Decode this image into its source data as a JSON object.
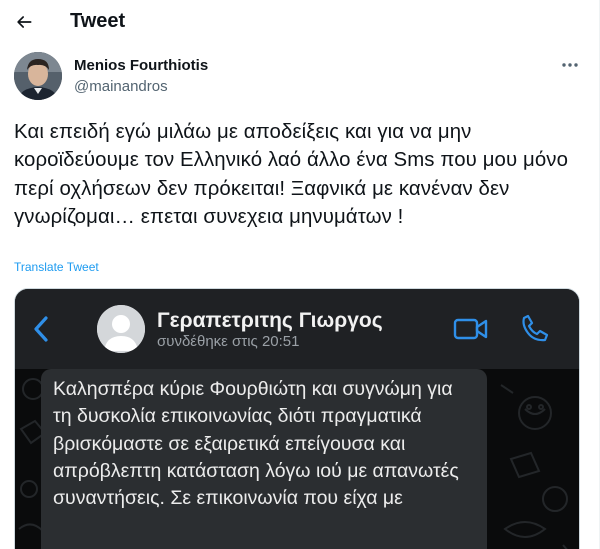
{
  "header": {
    "title": "Tweet",
    "back_icon": "arrow-left-icon"
  },
  "author": {
    "name": "Menios Fourthiotis",
    "handle": "@mainandros",
    "more_icon": "more-horizontal-icon"
  },
  "tweet": {
    "text": "Και επειδή εγώ μιλάω με αποδείξεις και για να μην κοροϊδεύουμε τον Ελληνικό λαό άλλο ένα Sms που μου μόνο περί οχλήσεων δεν πρόκειται! Ξαφνικά με κανέναν δεν γνωρίζομαι… επεται συνεχεια μηνυμάτων !",
    "translate_label": "Translate Tweet"
  },
  "media": {
    "contact_name": "Γεραπετριτης Γιωργος",
    "contact_status": "συνδέθηκε στις 20:51",
    "message_text": "Καλησπέρα κύριε Φουρθιώτη και συγνώμη για τη δυσκολία επικοινωνίας διότι πραγματικά βρισκόμαστε σε εξαιρετικά επείγουσα και απρόβλεπτη κατάσταση λόγω ιού με απανωτές συναντήσεις. Σε επικοινωνία που είχα  με",
    "icons": [
      "chevron-left-icon",
      "default-avatar-icon",
      "video-call-icon",
      "phone-call-icon"
    ],
    "colors": {
      "accent": "#2f8fe8",
      "header_bg": "#1f2124",
      "bubble_bg": "#2b2e31"
    }
  },
  "colors": {
    "link": "#1d9bf0",
    "text": "#0f1419",
    "secondary": "#536471"
  }
}
